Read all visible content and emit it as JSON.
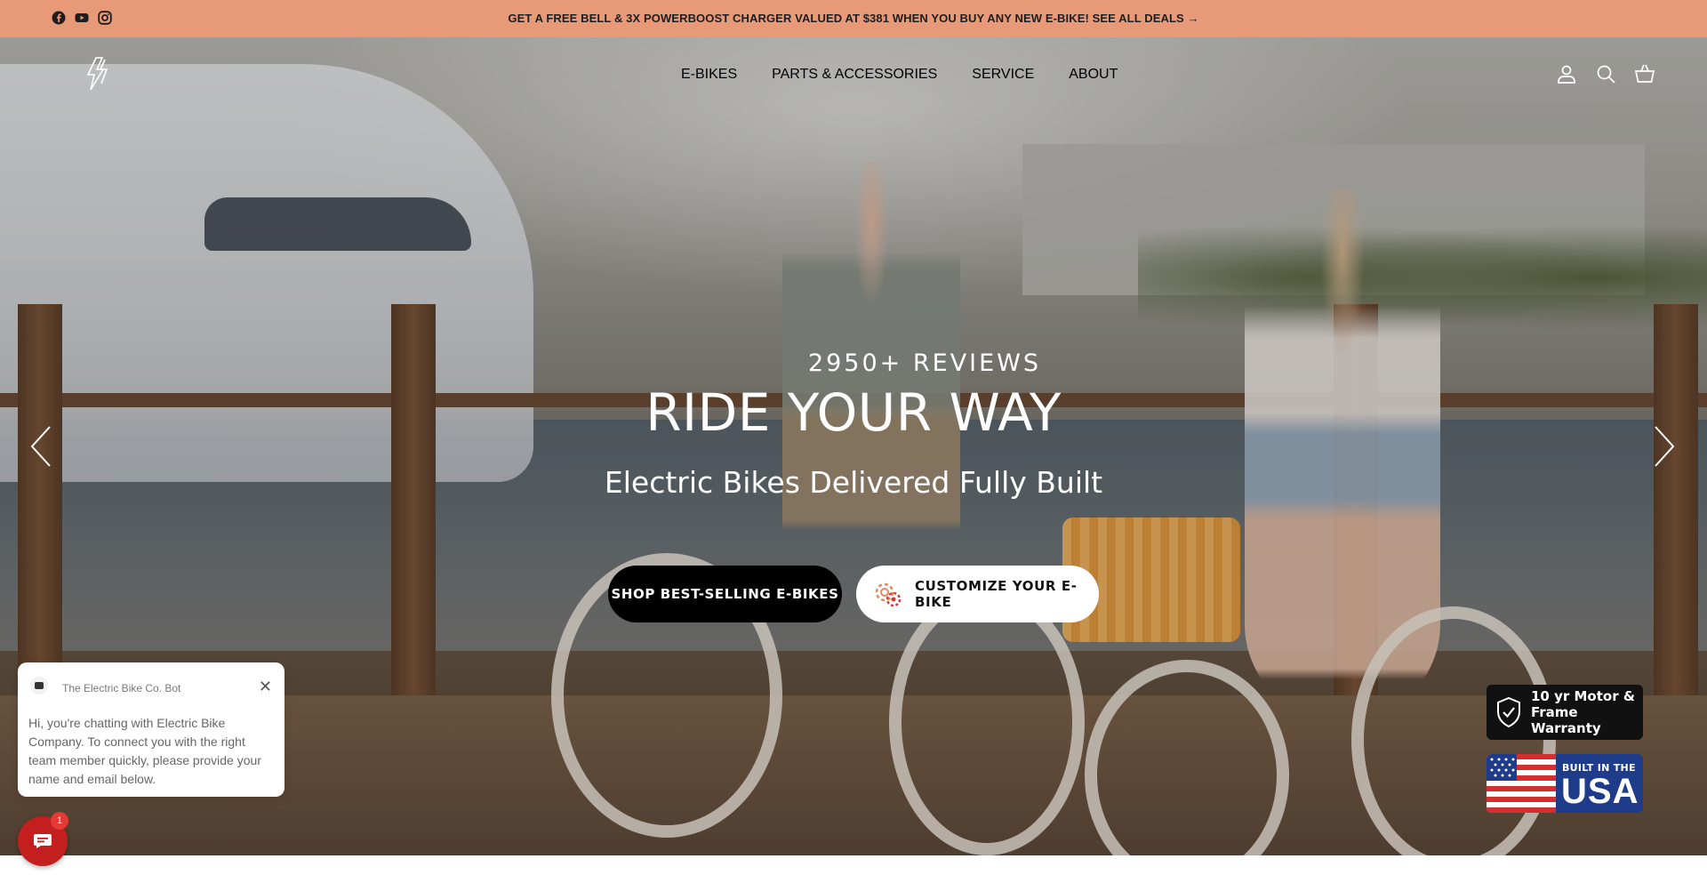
{
  "announcement": {
    "text": "GET A FREE BELL & 3X POWERBOOST CHARGER VALUED AT $381 WHEN YOU BUY ANY NEW E-BIKE! SEE ALL DEALS →",
    "background": "#e89a78"
  },
  "social": {
    "icons": [
      "facebook-icon",
      "youtube-icon",
      "instagram-icon"
    ]
  },
  "nav": {
    "items": [
      {
        "label": "E-BIKES"
      },
      {
        "label": "PARTS & ACCESSORIES"
      },
      {
        "label": "SERVICE"
      },
      {
        "label": "ABOUT"
      }
    ]
  },
  "header_icons": [
    "account-icon",
    "search-icon",
    "cart-icon"
  ],
  "hero": {
    "reviews": "2950+ REVIEWS",
    "headline": "RIDE YOUR WAY",
    "subheadline": "Electric Bikes Delivered Fully Built",
    "primary_button": "SHOP BEST-SELLING E-BIKES",
    "secondary_button": "CUSTOMIZE YOUR E-BIKE"
  },
  "chat": {
    "bot_name": "The Electric Bike Co. Bot",
    "message": "Hi, you're chatting with Electric Bike Company. To connect you with the right team member quickly, please provide your name and email below.",
    "close": "✕",
    "unread_count": "1",
    "launcher_color": "#c41f1f"
  },
  "badges": {
    "warranty": "10 yr Motor & Frame Warranty",
    "usa_small": "BUILT IN THE",
    "usa_big": "USA"
  }
}
